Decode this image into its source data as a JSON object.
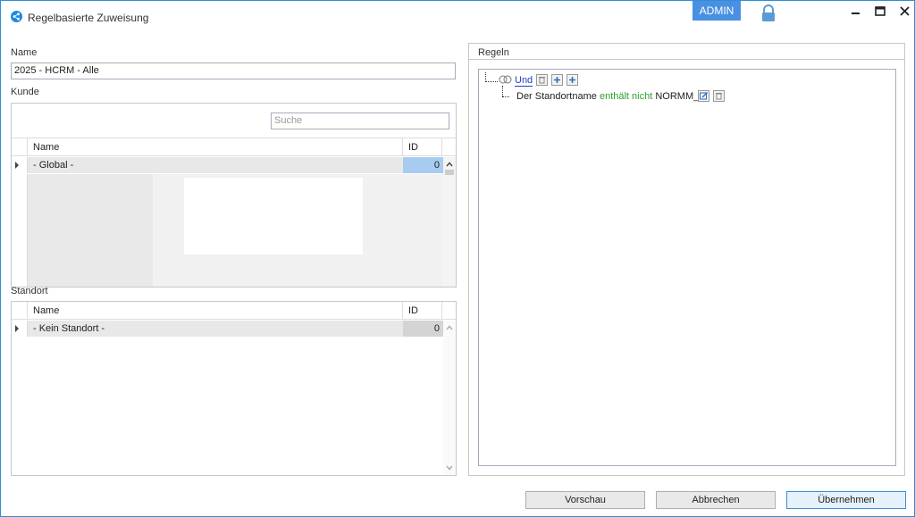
{
  "window": {
    "title": "Regelbasierte Zuweisung",
    "admin_badge": "ADMIN",
    "controls": [
      "minimize-icon",
      "maximize-icon",
      "close-icon"
    ]
  },
  "form": {
    "name_label": "Name",
    "name_value": "2025 - HCRM - Alle",
    "kunde_label": "Kunde",
    "standort_label": "Standort",
    "search_placeholder": "Suche"
  },
  "kunde_grid": {
    "columns": [
      "Name",
      "ID"
    ],
    "rows": [
      {
        "name": "- Global -",
        "id": "0"
      }
    ]
  },
  "standort_grid": {
    "columns": [
      "Name",
      "ID"
    ],
    "rows": [
      {
        "name": "- Kein Standort -",
        "id": "0"
      }
    ]
  },
  "rules": {
    "panel_label": "Regeln",
    "root_operator": "Und",
    "condition": {
      "field": "Der Standortname",
      "operator": "enthält nicht",
      "value": "NORMM_"
    }
  },
  "buttons": {
    "preview": "Vorschau",
    "cancel": "Abbrechen",
    "apply": "Übernehmen"
  },
  "colors": {
    "accent": "#1e88e5",
    "admin_bg": "#4a90e2",
    "operator_text": "#2ca02c",
    "link_text": "#1a3fc7"
  }
}
